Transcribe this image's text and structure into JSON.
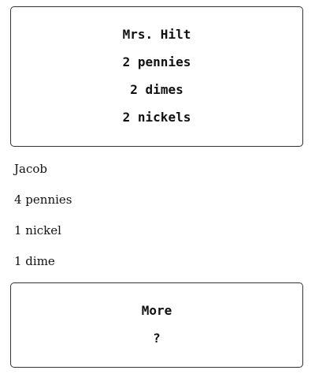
{
  "top_card": {
    "lines": [
      "Mrs. Hilt",
      "2 pennies",
      "2 dimes",
      "2 nickels"
    ]
  },
  "middle": {
    "lines": [
      "Jacob",
      "4 pennies",
      "1 nickel",
      "1 dime"
    ]
  },
  "bottom_card": {
    "lines": [
      "More",
      "?"
    ]
  }
}
